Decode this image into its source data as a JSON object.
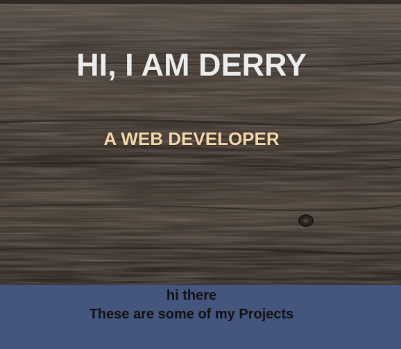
{
  "hero": {
    "title": "HI, I AM DERRY",
    "subtitle": "A WEB DEVELOPER",
    "background": "dark wood plank texture"
  },
  "projects": {
    "greeting": "hi there",
    "heading": "These are some of my Projects"
  },
  "colors": {
    "title": "#ececec",
    "subtitle": "#f5d9a8",
    "band": "#44557e",
    "band_text": "#111111",
    "wood_base": "#3d3630"
  }
}
